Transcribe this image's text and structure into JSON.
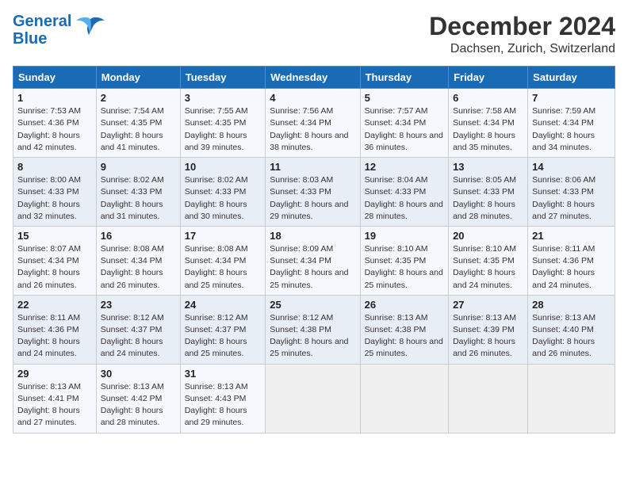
{
  "header": {
    "logo_line1": "General",
    "logo_line2": "Blue",
    "title": "December 2024",
    "subtitle": "Dachsen, Zurich, Switzerland"
  },
  "calendar": {
    "days_of_week": [
      "Sunday",
      "Monday",
      "Tuesday",
      "Wednesday",
      "Thursday",
      "Friday",
      "Saturday"
    ],
    "weeks": [
      [
        {
          "day": "1",
          "sunrise": "Sunrise: 7:53 AM",
          "sunset": "Sunset: 4:36 PM",
          "daylight": "Daylight: 8 hours and 42 minutes."
        },
        {
          "day": "2",
          "sunrise": "Sunrise: 7:54 AM",
          "sunset": "Sunset: 4:35 PM",
          "daylight": "Daylight: 8 hours and 41 minutes."
        },
        {
          "day": "3",
          "sunrise": "Sunrise: 7:55 AM",
          "sunset": "Sunset: 4:35 PM",
          "daylight": "Daylight: 8 hours and 39 minutes."
        },
        {
          "day": "4",
          "sunrise": "Sunrise: 7:56 AM",
          "sunset": "Sunset: 4:34 PM",
          "daylight": "Daylight: 8 hours and 38 minutes."
        },
        {
          "day": "5",
          "sunrise": "Sunrise: 7:57 AM",
          "sunset": "Sunset: 4:34 PM",
          "daylight": "Daylight: 8 hours and 36 minutes."
        },
        {
          "day": "6",
          "sunrise": "Sunrise: 7:58 AM",
          "sunset": "Sunset: 4:34 PM",
          "daylight": "Daylight: 8 hours and 35 minutes."
        },
        {
          "day": "7",
          "sunrise": "Sunrise: 7:59 AM",
          "sunset": "Sunset: 4:34 PM",
          "daylight": "Daylight: 8 hours and 34 minutes."
        }
      ],
      [
        {
          "day": "8",
          "sunrise": "Sunrise: 8:00 AM",
          "sunset": "Sunset: 4:33 PM",
          "daylight": "Daylight: 8 hours and 32 minutes."
        },
        {
          "day": "9",
          "sunrise": "Sunrise: 8:02 AM",
          "sunset": "Sunset: 4:33 PM",
          "daylight": "Daylight: 8 hours and 31 minutes."
        },
        {
          "day": "10",
          "sunrise": "Sunrise: 8:02 AM",
          "sunset": "Sunset: 4:33 PM",
          "daylight": "Daylight: 8 hours and 30 minutes."
        },
        {
          "day": "11",
          "sunrise": "Sunrise: 8:03 AM",
          "sunset": "Sunset: 4:33 PM",
          "daylight": "Daylight: 8 hours and 29 minutes."
        },
        {
          "day": "12",
          "sunrise": "Sunrise: 8:04 AM",
          "sunset": "Sunset: 4:33 PM",
          "daylight": "Daylight: 8 hours and 28 minutes."
        },
        {
          "day": "13",
          "sunrise": "Sunrise: 8:05 AM",
          "sunset": "Sunset: 4:33 PM",
          "daylight": "Daylight: 8 hours and 28 minutes."
        },
        {
          "day": "14",
          "sunrise": "Sunrise: 8:06 AM",
          "sunset": "Sunset: 4:33 PM",
          "daylight": "Daylight: 8 hours and 27 minutes."
        }
      ],
      [
        {
          "day": "15",
          "sunrise": "Sunrise: 8:07 AM",
          "sunset": "Sunset: 4:34 PM",
          "daylight": "Daylight: 8 hours and 26 minutes."
        },
        {
          "day": "16",
          "sunrise": "Sunrise: 8:08 AM",
          "sunset": "Sunset: 4:34 PM",
          "daylight": "Daylight: 8 hours and 26 minutes."
        },
        {
          "day": "17",
          "sunrise": "Sunrise: 8:08 AM",
          "sunset": "Sunset: 4:34 PM",
          "daylight": "Daylight: 8 hours and 25 minutes."
        },
        {
          "day": "18",
          "sunrise": "Sunrise: 8:09 AM",
          "sunset": "Sunset: 4:34 PM",
          "daylight": "Daylight: 8 hours and 25 minutes."
        },
        {
          "day": "19",
          "sunrise": "Sunrise: 8:10 AM",
          "sunset": "Sunset: 4:35 PM",
          "daylight": "Daylight: 8 hours and 25 minutes."
        },
        {
          "day": "20",
          "sunrise": "Sunrise: 8:10 AM",
          "sunset": "Sunset: 4:35 PM",
          "daylight": "Daylight: 8 hours and 24 minutes."
        },
        {
          "day": "21",
          "sunrise": "Sunrise: 8:11 AM",
          "sunset": "Sunset: 4:36 PM",
          "daylight": "Daylight: 8 hours and 24 minutes."
        }
      ],
      [
        {
          "day": "22",
          "sunrise": "Sunrise: 8:11 AM",
          "sunset": "Sunset: 4:36 PM",
          "daylight": "Daylight: 8 hours and 24 minutes."
        },
        {
          "day": "23",
          "sunrise": "Sunrise: 8:12 AM",
          "sunset": "Sunset: 4:37 PM",
          "daylight": "Daylight: 8 hours and 24 minutes."
        },
        {
          "day": "24",
          "sunrise": "Sunrise: 8:12 AM",
          "sunset": "Sunset: 4:37 PM",
          "daylight": "Daylight: 8 hours and 25 minutes."
        },
        {
          "day": "25",
          "sunrise": "Sunrise: 8:12 AM",
          "sunset": "Sunset: 4:38 PM",
          "daylight": "Daylight: 8 hours and 25 minutes."
        },
        {
          "day": "26",
          "sunrise": "Sunrise: 8:13 AM",
          "sunset": "Sunset: 4:38 PM",
          "daylight": "Daylight: 8 hours and 25 minutes."
        },
        {
          "day": "27",
          "sunrise": "Sunrise: 8:13 AM",
          "sunset": "Sunset: 4:39 PM",
          "daylight": "Daylight: 8 hours and 26 minutes."
        },
        {
          "day": "28",
          "sunrise": "Sunrise: 8:13 AM",
          "sunset": "Sunset: 4:40 PM",
          "daylight": "Daylight: 8 hours and 26 minutes."
        }
      ],
      [
        {
          "day": "29",
          "sunrise": "Sunrise: 8:13 AM",
          "sunset": "Sunset: 4:41 PM",
          "daylight": "Daylight: 8 hours and 27 minutes."
        },
        {
          "day": "30",
          "sunrise": "Sunrise: 8:13 AM",
          "sunset": "Sunset: 4:42 PM",
          "daylight": "Daylight: 8 hours and 28 minutes."
        },
        {
          "day": "31",
          "sunrise": "Sunrise: 8:13 AM",
          "sunset": "Sunset: 4:43 PM",
          "daylight": "Daylight: 8 hours and 29 minutes."
        },
        null,
        null,
        null,
        null
      ]
    ]
  }
}
